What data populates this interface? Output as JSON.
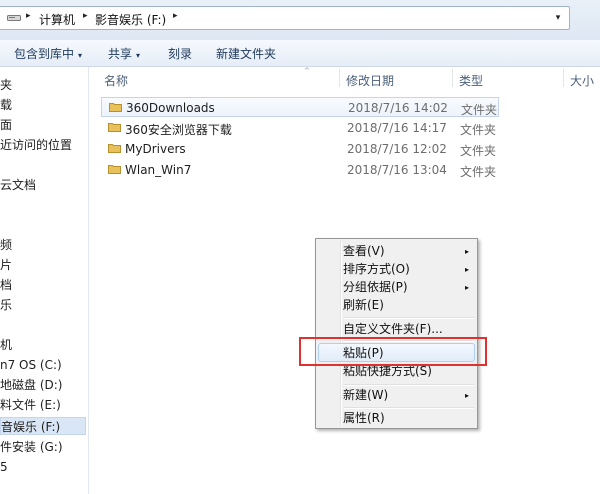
{
  "address": {
    "crumbs": [
      "计算机",
      "影音娱乐 (F:)"
    ],
    "separator": "▸",
    "drop": "▾"
  },
  "toolbar": {
    "include_library": "包含到库中",
    "share": "共享",
    "burn": "刻录",
    "new_folder": "新建文件夹",
    "caret": "▾"
  },
  "nav": [
    "夹",
    "载",
    "面",
    "近访问的位置",
    "云文档",
    "频",
    "片",
    "档",
    "乐",
    "机",
    "n7 OS (C:)",
    "地磁盘 (D:)",
    "料文件 (E:)",
    "音娱乐 (F:)",
    "件安装 (G:)",
    "5"
  ],
  "columns": {
    "name": "名称",
    "date": "修改日期",
    "type": "类型",
    "size": "大小",
    "sort": "^"
  },
  "files": [
    {
      "name": "360Downloads",
      "date": "2018/7/16 14:02",
      "type": "文件夹"
    },
    {
      "name": "360安全浏览器下载",
      "date": "2018/7/16 14:17",
      "type": "文件夹"
    },
    {
      "name": "MyDrivers",
      "date": "2018/7/16 12:02",
      "type": "文件夹"
    },
    {
      "name": "Wlan_Win7",
      "date": "2018/7/16 13:04",
      "type": "文件夹"
    }
  ],
  "context_menu": {
    "view": "查看(V)",
    "sort": "排序方式(O)",
    "group": "分组依据(P)",
    "refresh": "刷新(E)",
    "customize": "自定义文件夹(F)...",
    "paste": "粘贴(P)",
    "paste_shortcut": "粘贴快捷方式(S)",
    "new": "新建(W)",
    "properties": "属性(R)",
    "submenu_arrow": "▸"
  },
  "colors": {
    "highlight": "#e03030",
    "folder": "#e8c15a",
    "accent": "#1e395b"
  }
}
